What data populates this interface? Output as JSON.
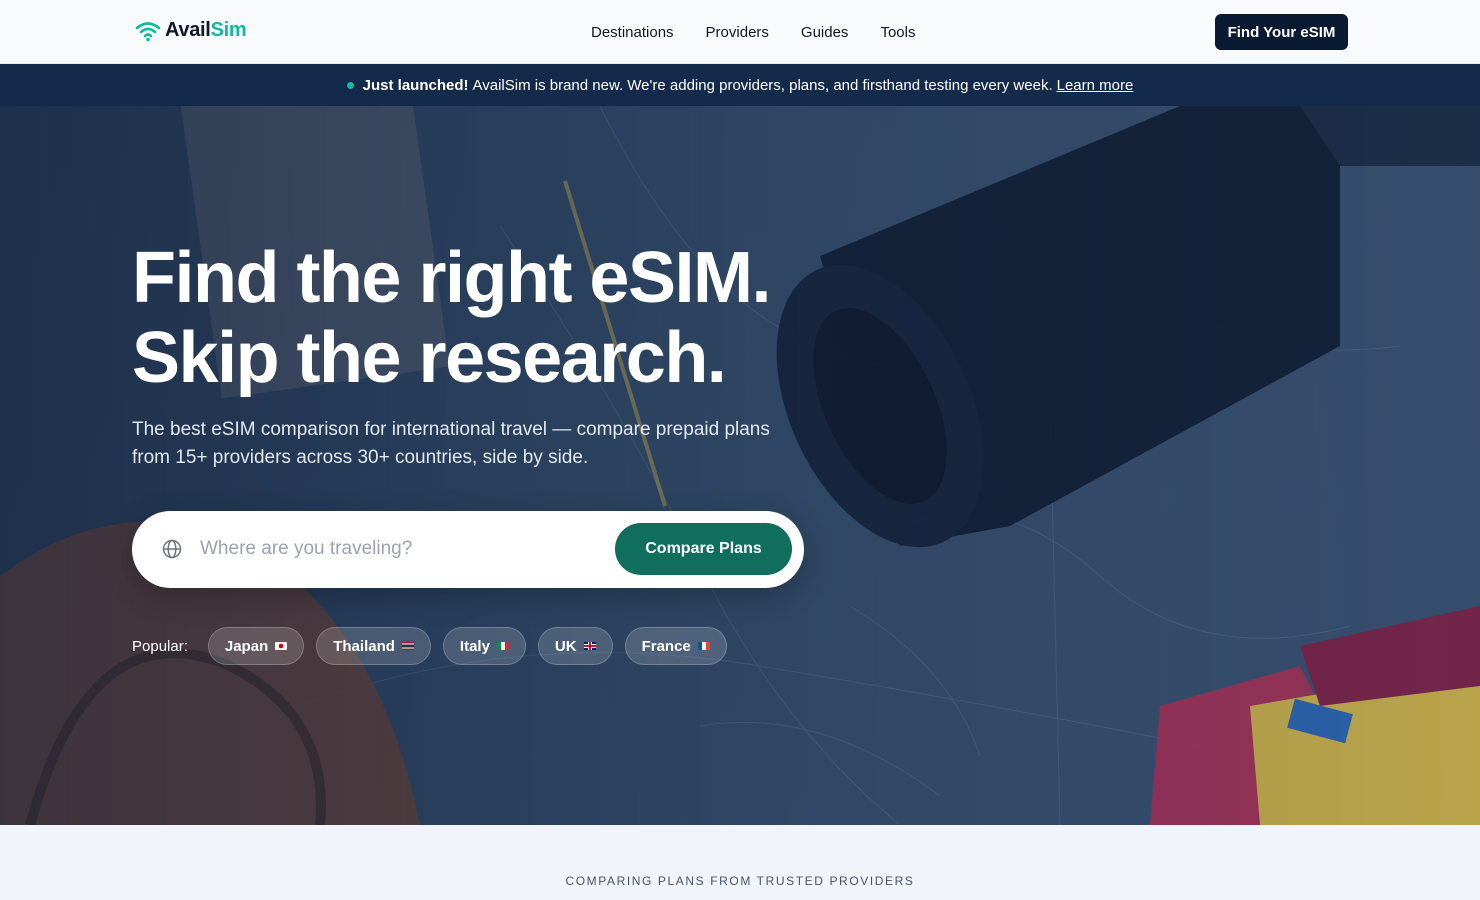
{
  "brand": {
    "name_part1": "Avail",
    "name_part2": "Sim",
    "accent": "#10b9a0"
  },
  "nav": {
    "items": [
      {
        "label": "Destinations"
      },
      {
        "label": "Providers"
      },
      {
        "label": "Guides"
      },
      {
        "label": "Tools"
      }
    ],
    "cta_label": "Find Your eSIM"
  },
  "announcement": {
    "bold": "Just launched!",
    "text": "AvailSim is brand new. We're adding providers, plans, and firsthand testing every week.",
    "link": "Learn more"
  },
  "hero": {
    "title_line1": "Find the right eSIM.",
    "title_line2": "Skip the research.",
    "subtitle": "The best eSIM comparison for international travel — compare prepaid plans from 15+ providers across 30+ countries, side by side.",
    "search_placeholder": "Where are you traveling?",
    "search_value": "",
    "compare_label": "Compare Plans",
    "popular_label": "Popular:",
    "popular": [
      {
        "label": "Japan",
        "flag": "japan-flag-icon"
      },
      {
        "label": "Thailand",
        "flag": "thailand-flag-icon"
      },
      {
        "label": "Italy",
        "flag": "italy-flag-icon"
      },
      {
        "label": "UK",
        "flag": "uk-flag-icon"
      },
      {
        "label": "France",
        "flag": "france-flag-icon"
      }
    ]
  },
  "providers_section": {
    "label": "COMPARING PLANS FROM TRUSTED PROVIDERS"
  },
  "colors": {
    "nav_dark": "#0b1a33",
    "announce_bg": "#142a4a",
    "compare_green": "#0f6e5c"
  }
}
